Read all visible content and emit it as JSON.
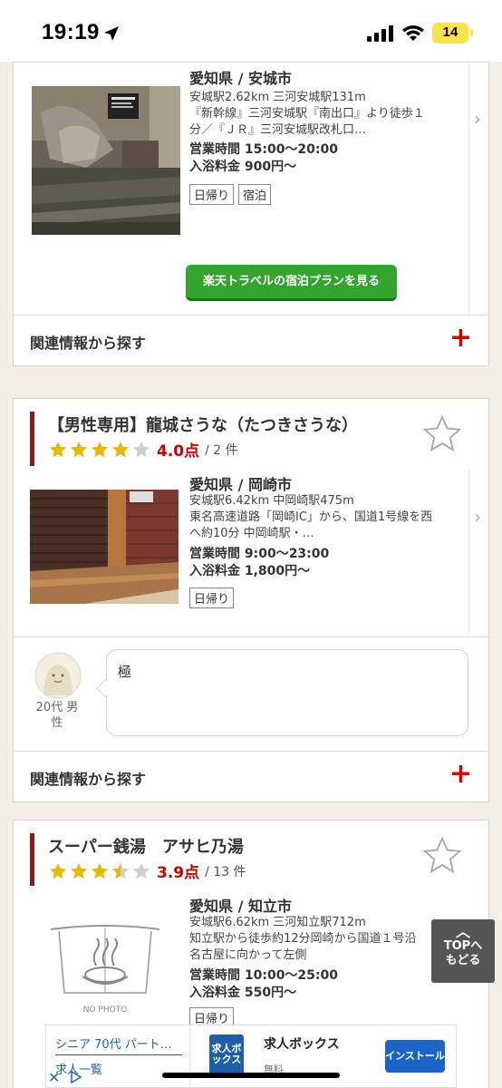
{
  "status_bar": {
    "time": "19:19",
    "battery": "14"
  },
  "card1": {
    "location": "愛知県 / 安城市",
    "access_line1": "安城駅2.62km 三河安城駅131m",
    "access_line2": "『新幹線』三河安城駅『南出口』より徒歩１",
    "access_line3": "分／『ＪＲ』三河安城駅改札口…",
    "hours": "営業時間 15:00〜20:00",
    "fee": "入浴料金 900円〜",
    "tags": [
      "日帰り",
      "宿泊"
    ],
    "button": "楽天トラベルの宿泊プランを見る",
    "related": "関連情報から探す"
  },
  "card2": {
    "title": "【男性専用】龍城さうな（たつきさうな）",
    "rating": 4.0,
    "score": "4.0点",
    "count": "/ 2 件",
    "location": "愛知県 / 岡崎市",
    "access_line1": "安城駅6.42km 中岡崎駅475m",
    "access_line2": "東名高速道路「岡崎IC」から、国道1号線を西",
    "access_line3": "へ約10分 中岡崎駅・…",
    "hours": "営業時間 9:00〜23:00",
    "fee": "入浴料金 1,800円〜",
    "tags": [
      "日帰り"
    ],
    "review_text": "極",
    "reviewer_line1": "20代 男",
    "reviewer_line2": "性",
    "related": "関連情報から探す"
  },
  "card3": {
    "title": "スーパー銭湯　アサヒ乃湯",
    "rating": 3.5,
    "score": "3.9点",
    "count": "/ 13 件",
    "location": "愛知県 / 知立市",
    "access_line1": "安城駅6.62km 三河知立駅712m",
    "access_line2": "知立駅から徒歩約12分岡崎から国道１号沿",
    "access_line3": "名古屋に向かって左側",
    "hours": "営業時間 10:00〜25:00",
    "fee": "入浴料金 550円〜",
    "tags": [
      "日帰り"
    ],
    "no_photo": "NO PHOTO"
  },
  "to_top": {
    "line1": "TOPへ",
    "line2": "もどる"
  },
  "ad": {
    "link1": "シニア 70代 パート…",
    "link2": "求人一覧",
    "icon_text": "求人ボックス",
    "app_name": "求人ボックス",
    "price": "無料",
    "install": "インストール"
  },
  "colors": {
    "accent_red": "#c40000",
    "title_bar": "#8b1a1a",
    "button_green": "#33a52f",
    "star": "#e6b800"
  }
}
